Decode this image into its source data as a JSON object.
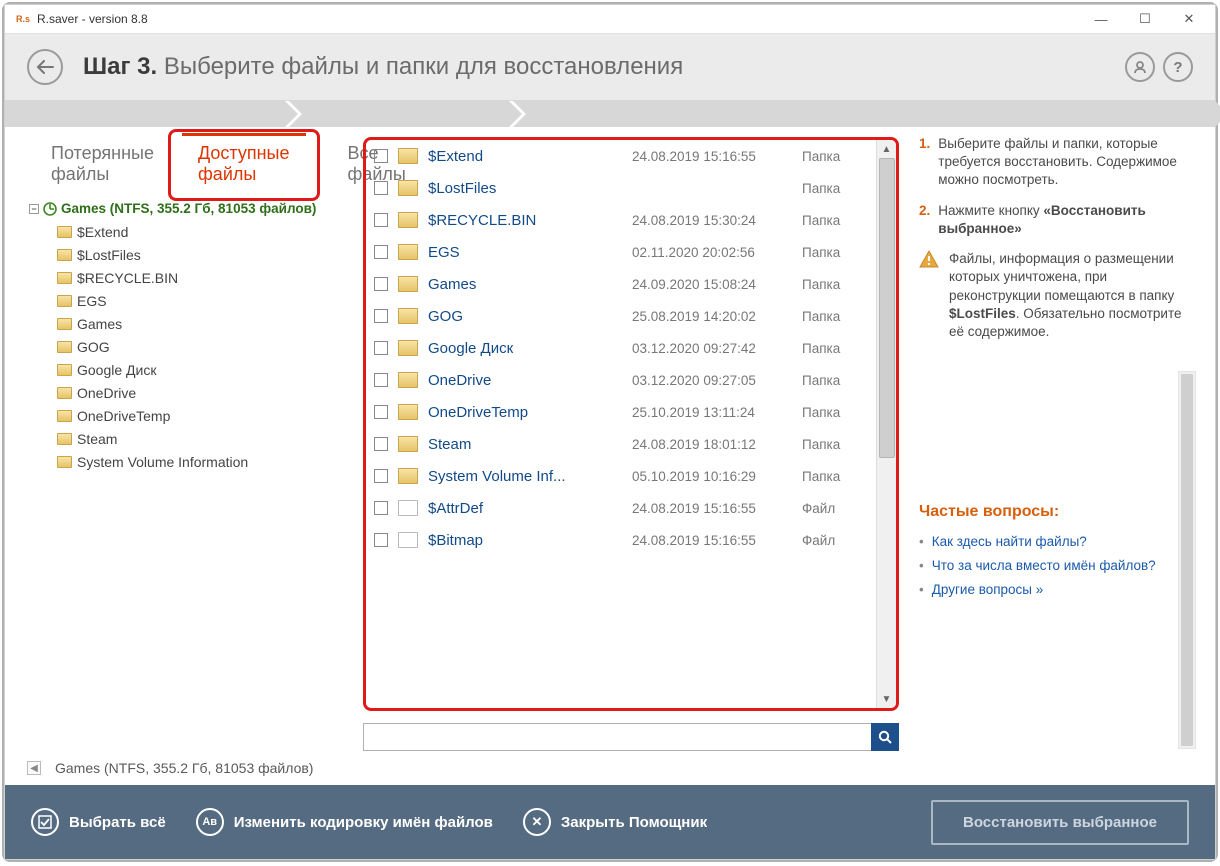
{
  "window": {
    "title": "R.saver - version 8.8",
    "icon_text": "R.s"
  },
  "header": {
    "step_prefix": "Шаг 3.",
    "step_text": "Выберите файлы и папки для восстановления"
  },
  "tabs": {
    "lost": "Потерянные файлы",
    "available": "Доступные файлы",
    "all": "Все файлы"
  },
  "tree": {
    "root": "Games (NTFS, 355.2 Гб, 81053 файлов)",
    "items": [
      "$Extend",
      "$LostFiles",
      "$RECYCLE.BIN",
      "EGS",
      "Games",
      "GOG",
      "Google Диск",
      "OneDrive",
      "OneDriveTemp",
      "Steam",
      "System Volume Information"
    ]
  },
  "files": [
    {
      "name": "$Extend",
      "date": "24.08.2019 15:16:55",
      "type": "Папка",
      "kind": "folder"
    },
    {
      "name": "$LostFiles",
      "date": "",
      "type": "Папка",
      "kind": "folder"
    },
    {
      "name": "$RECYCLE.BIN",
      "date": "24.08.2019 15:30:24",
      "type": "Папка",
      "kind": "folder"
    },
    {
      "name": "EGS",
      "date": "02.11.2020 20:02:56",
      "type": "Папка",
      "kind": "folder"
    },
    {
      "name": "Games",
      "date": "24.09.2020 15:08:24",
      "type": "Папка",
      "kind": "folder"
    },
    {
      "name": "GOG",
      "date": "25.08.2019 14:20:02",
      "type": "Папка",
      "kind": "folder"
    },
    {
      "name": "Google Диск",
      "date": "03.12.2020 09:27:42",
      "type": "Папка",
      "kind": "folder"
    },
    {
      "name": "OneDrive",
      "date": "03.12.2020 09:27:05",
      "type": "Папка",
      "kind": "folder"
    },
    {
      "name": "OneDriveTemp",
      "date": "25.10.2019 13:11:24",
      "type": "Папка",
      "kind": "folder"
    },
    {
      "name": "Steam",
      "date": "24.08.2019 18:01:12",
      "type": "Папка",
      "kind": "folder"
    },
    {
      "name": "System Volume Inf...",
      "date": "05.10.2019 10:16:29",
      "type": "Папка",
      "kind": "folder"
    },
    {
      "name": "$AttrDef",
      "date": "24.08.2019 15:16:55",
      "type": "Файл",
      "kind": "file"
    },
    {
      "name": "$Bitmap",
      "date": "24.08.2019 15:16:55",
      "type": "Файл",
      "kind": "file"
    }
  ],
  "instructions": {
    "num1": "1.",
    "step1": "Выберите файлы и папки, которые требуется восстановить. Содержимое можно посмотреть.",
    "num2": "2.",
    "step2_a": "Нажмите кнопку ",
    "step2_b": "«Восстановить выбранное»",
    "warn_a": "Файлы, информация о размещении которых уничтожена, при реконструкции помещаются в папку ",
    "warn_b": "$LostFiles",
    "warn_c": ". Обязательно посмотрите её содержимое."
  },
  "faq": {
    "title": "Частые вопросы:",
    "q1": "Как здесь найти файлы?",
    "q2": "Что за числа вместо имён файлов?",
    "q3": "Другие вопросы »"
  },
  "breadcrumb": "Games (NTFS, 355.2 Гб, 81053 файлов)",
  "footer": {
    "select_all": "Выбрать всё",
    "encoding": "Изменить кодировку имён файлов",
    "close": "Закрыть Помощник",
    "restore": "Восстановить выбранное"
  }
}
